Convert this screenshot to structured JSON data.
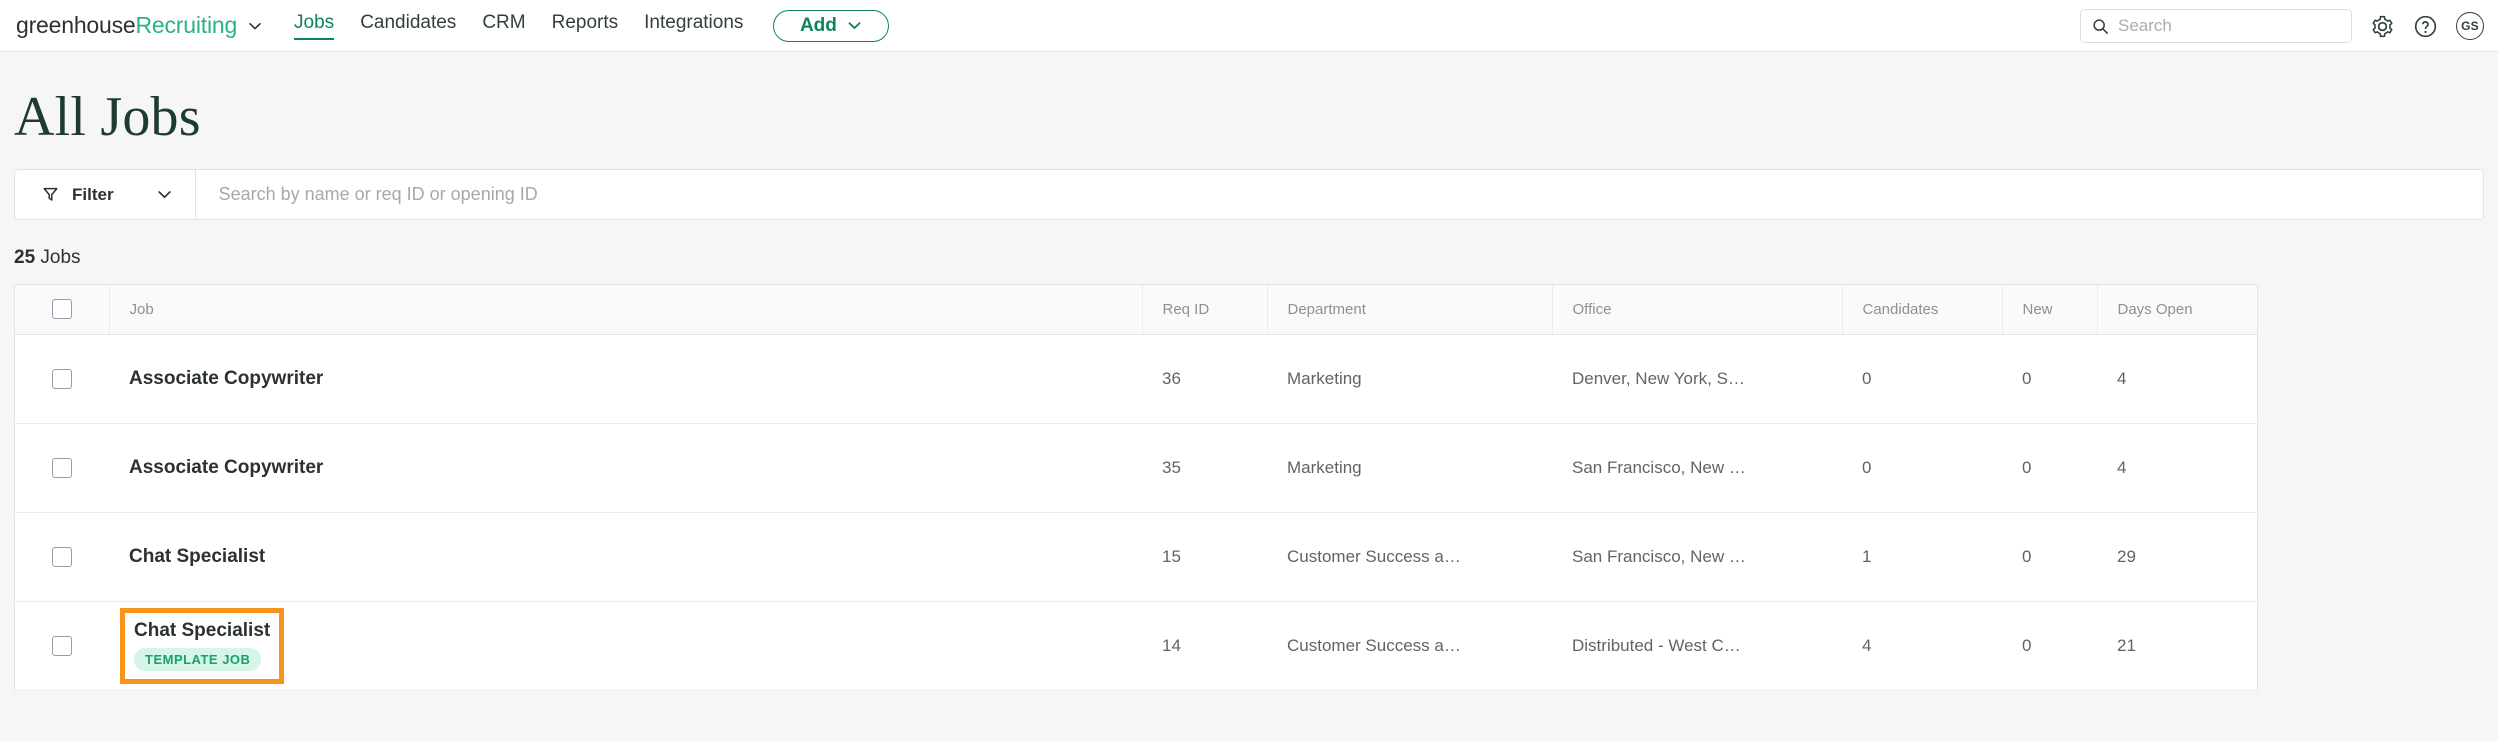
{
  "nav": {
    "brand_primary": "greenhouse",
    "brand_secondary": "Recruiting",
    "links": [
      {
        "label": "Jobs",
        "active": true
      },
      {
        "label": "Candidates",
        "active": false
      },
      {
        "label": "CRM",
        "active": false
      },
      {
        "label": "Reports",
        "active": false
      },
      {
        "label": "Integrations",
        "active": false
      }
    ],
    "add_label": "Add",
    "search_placeholder": "Search",
    "search_value": "",
    "avatar_initials": "GS"
  },
  "page": {
    "title": "All Jobs",
    "filter_label": "Filter",
    "table_search_placeholder": "Search by name or req ID or opening ID",
    "table_search_value": "",
    "count_number": "25",
    "count_label": "Jobs"
  },
  "table": {
    "headers": {
      "job": "Job",
      "req_id": "Req ID",
      "department": "Department",
      "office": "Office",
      "candidates": "Candidates",
      "new": "New",
      "days_open": "Days Open"
    },
    "rows": [
      {
        "job": "Associate Copywriter",
        "req_id": "36",
        "department": "Marketing",
        "office": "Denver, New York, S…",
        "candidates": "0",
        "new": "0",
        "days_open": "4",
        "badge": null,
        "highlighted": false
      },
      {
        "job": "Associate Copywriter",
        "req_id": "35",
        "department": "Marketing",
        "office": "San Francisco, New …",
        "candidates": "0",
        "new": "0",
        "days_open": "4",
        "badge": null,
        "highlighted": false
      },
      {
        "job": "Chat Specialist",
        "req_id": "15",
        "department": "Customer Success a…",
        "office": "San Francisco, New …",
        "candidates": "1",
        "new": "0",
        "days_open": "29",
        "badge": null,
        "highlighted": false
      },
      {
        "job": "Chat Specialist",
        "req_id": "14",
        "department": "Customer Success a…",
        "office": "Distributed - West C…",
        "candidates": "4",
        "new": "0",
        "days_open": "21",
        "badge": "TEMPLATE JOB",
        "highlighted": true
      }
    ]
  },
  "colors": {
    "brand_green": "#2db37f",
    "accent_green": "#0f8261",
    "title_green": "#1d3b31",
    "highlight_orange": "#f7941d",
    "badge_bg": "#d6f5e6",
    "badge_text": "#1aa06d"
  }
}
